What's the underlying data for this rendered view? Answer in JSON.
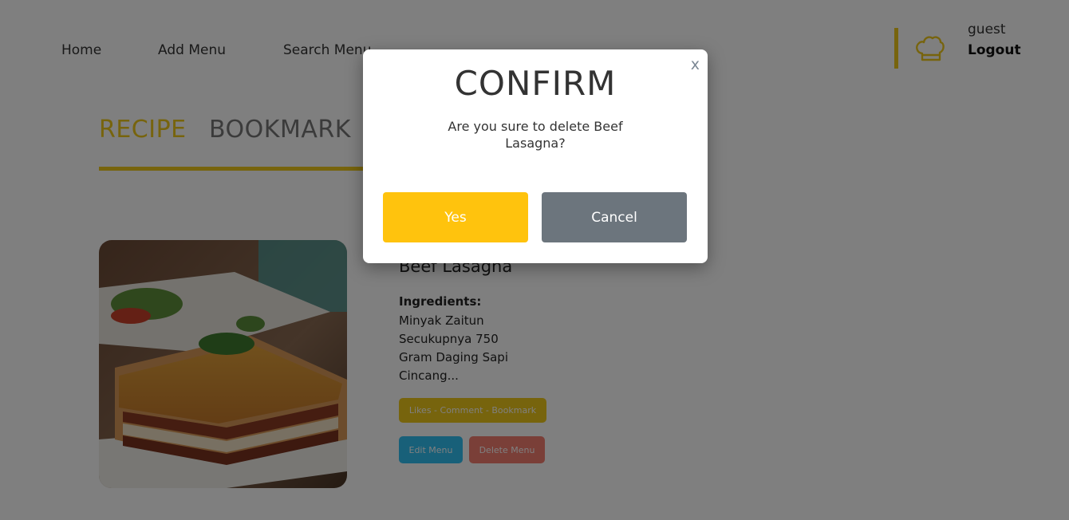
{
  "nav": {
    "home": "Home",
    "add_menu": "Add Menu",
    "search_menu": "Search Menu"
  },
  "user": {
    "name": "guest",
    "logout": "Logout"
  },
  "tabs": {
    "recipe": "RECIPE",
    "bookmark": "BOOKMARK"
  },
  "recipe": {
    "title": "Beef Lasagna",
    "ingredients_label": "Ingredients:",
    "ingredients_text": "Minyak Zaitun Secukupnya 750 Gram Daging Sapi Cincang...",
    "stats": "Likes - Comment - Bookmark",
    "edit_label": "Edit Menu",
    "delete_label": "Delete Menu"
  },
  "modal": {
    "close": "x",
    "title": "CONFIRM",
    "message": "Are you sure to delete Beef Lasagna?",
    "yes": "Yes",
    "cancel": "Cancel"
  },
  "colors": {
    "accent": "#EFC81A",
    "yes_button": "#FFC30D",
    "cancel_button": "#6C757D",
    "edit_button": "#30C0F3",
    "delete_button": "#F57E71"
  },
  "icons": {
    "user_avatar": "chef-hat-icon",
    "recipe_photo": "lasagna-photo"
  }
}
